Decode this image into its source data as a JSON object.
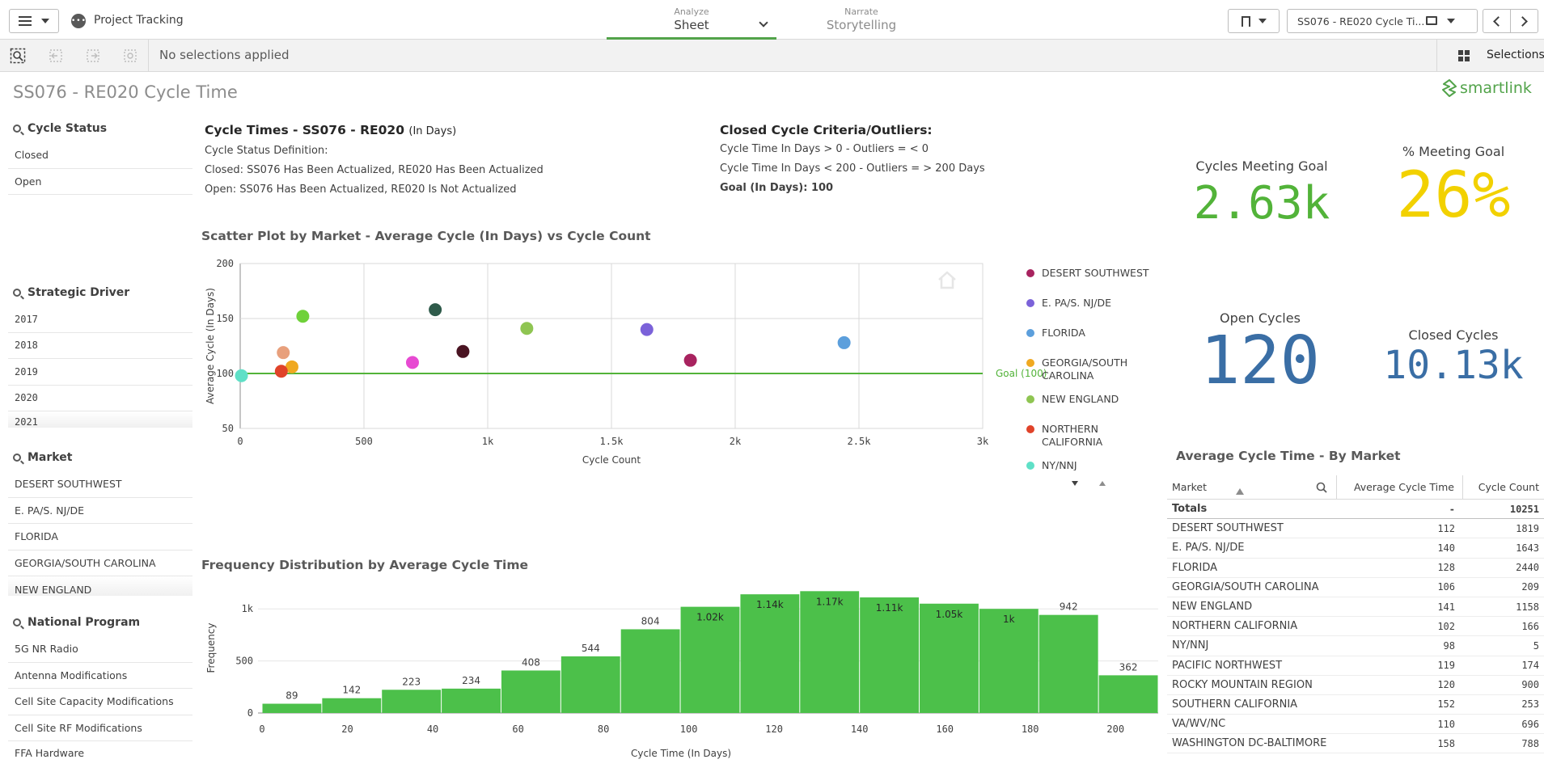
{
  "topbar": {
    "app_name": "Project Tracking",
    "tabs": [
      {
        "small": "Analyze",
        "big": "Sheet"
      },
      {
        "small": "Narrate",
        "big": "Storytelling"
      }
    ],
    "sheet_selector": "SS076 - RE020 Cycle Ti..."
  },
  "selection_bar": {
    "status": "No selections applied",
    "selections_label": "Selections"
  },
  "sheet": {
    "title": "SS076 - RE020 Cycle Time",
    "logo_text": "smartlink"
  },
  "filters": [
    {
      "title": "Cycle Status",
      "items": [
        "Closed",
        "Open"
      ]
    },
    {
      "title": "Strategic Driver",
      "items": [
        "2017",
        "2018",
        "2019",
        "2020",
        "2021"
      ]
    },
    {
      "title": "Market",
      "items": [
        "DESERT SOUTHWEST",
        "E. PA/S. NJ/DE",
        "FLORIDA",
        "GEORGIA/SOUTH CAROLINA",
        "NEW ENGLAND"
      ]
    },
    {
      "title": "National Program",
      "items": [
        "5G NR Radio",
        "Antenna Modifications",
        "Cell Site Capacity Modifications",
        "Cell Site RF Modifications",
        "FFA Hardware"
      ]
    }
  ],
  "definitions": {
    "title": "Cycle Times - SS076 - RE020",
    "title_suffix": "(In Days)",
    "line1": "Cycle Status Definition:",
    "line2": "Closed: SS076 Has Been Actualized, RE020 Has Been Actualized",
    "line3": "Open: SS076 Has Been Actualized, RE020 Is Not Actualized"
  },
  "criteria": {
    "title": "Closed Cycle Criteria/Outliers:",
    "line1": "Cycle Time In Days > 0 - Outliers = < 0",
    "line2": "Cycle Time In Days < 200 - Outliers = > 200 Days",
    "goal_label": "Goal (In Days): 100"
  },
  "kpis": {
    "meeting_goal": {
      "label": "Cycles Meeting Goal",
      "value": "2.63k",
      "color": "#52b339"
    },
    "pct_meeting": {
      "label": "% Meeting Goal",
      "value": "26%",
      "color": "#f2d100"
    },
    "open_cycles": {
      "label": "Open Cycles",
      "value": "120",
      "color": "#3a6ea5"
    },
    "closed_cycles": {
      "label": "Closed Cycles",
      "value": "10.13k",
      "color": "#3a6ea5"
    }
  },
  "scatter": {
    "title": "Scatter Plot by Market - Average Cycle (In Days) vs Cycle Count",
    "goal_label": "Goal (100)",
    "legend_visible": [
      "DESERT SOUTHWEST",
      "E. PA/S. NJ/DE",
      "FLORIDA",
      "GEORGIA/SOUTH CAROLINA",
      "NEW ENGLAND",
      "NORTHERN CALIFORNIA",
      "NY/NNJ"
    ]
  },
  "histogram": {
    "title": "Frequency Distribution by Average Cycle Time"
  },
  "table": {
    "title": "Average Cycle Time - By Market",
    "headers": [
      "Market",
      "Average Cycle Time",
      "Cycle Count"
    ],
    "totals": [
      "Totals",
      "-",
      "10251"
    ],
    "rows": [
      [
        "DESERT SOUTHWEST",
        "112",
        "1819"
      ],
      [
        "E. PA/S. NJ/DE",
        "140",
        "1643"
      ],
      [
        "FLORIDA",
        "128",
        "2440"
      ],
      [
        "GEORGIA/SOUTH CAROLINA",
        "106",
        "209"
      ],
      [
        "NEW ENGLAND",
        "141",
        "1158"
      ],
      [
        "NORTHERN CALIFORNIA",
        "102",
        "166"
      ],
      [
        "NY/NNJ",
        "98",
        "5"
      ],
      [
        "PACIFIC NORTHWEST",
        "119",
        "174"
      ],
      [
        "ROCKY MOUNTAIN REGION",
        "120",
        "900"
      ],
      [
        "SOUTHERN CALIFORNIA",
        "152",
        "253"
      ],
      [
        "VA/WV/NC",
        "110",
        "696"
      ],
      [
        "WASHINGTON DC-BALTIMORE",
        "158",
        "788"
      ]
    ]
  },
  "chart_data": [
    {
      "type": "scatter",
      "title": "Scatter Plot by Market - Average Cycle (In Days) vs Cycle Count",
      "xlabel": "Cycle Count",
      "ylabel": "Average Cycle (In Days)",
      "xlim": [
        0,
        3000
      ],
      "ylim": [
        50,
        200
      ],
      "x_ticks": [
        0,
        500,
        1000,
        1500,
        2000,
        2500,
        3000
      ],
      "x_tick_labels": [
        "0",
        "500",
        "1k",
        "1.5k",
        "2k",
        "2.5k",
        "3k"
      ],
      "y_ticks": [
        50,
        100,
        150,
        200
      ],
      "reference_line": {
        "y": 100,
        "label": "Goal (100)",
        "color": "#52b339"
      },
      "legend_position": "right",
      "points": [
        {
          "name": "DESERT SOUTHWEST",
          "x": 1819,
          "y": 112,
          "color": "#a8235f"
        },
        {
          "name": "E. PA/S. NJ/DE",
          "x": 1643,
          "y": 140,
          "color": "#7b62d9"
        },
        {
          "name": "FLORIDA",
          "x": 2440,
          "y": 128,
          "color": "#5c9fdc"
        },
        {
          "name": "GEORGIA/SOUTH CAROLINA",
          "x": 209,
          "y": 106,
          "color": "#f0a921"
        },
        {
          "name": "NEW ENGLAND",
          "x": 1158,
          "y": 141,
          "color": "#8fc552"
        },
        {
          "name": "NORTHERN CALIFORNIA",
          "x": 166,
          "y": 102,
          "color": "#e0432a"
        },
        {
          "name": "NY/NNJ",
          "x": 5,
          "y": 98,
          "color": "#5fe0c7"
        },
        {
          "name": "PACIFIC NORTHWEST",
          "x": 174,
          "y": 119,
          "color": "#e8a07c"
        },
        {
          "name": "ROCKY MOUNTAIN REGION",
          "x": 900,
          "y": 120,
          "color": "#4a1422"
        },
        {
          "name": "SOUTHERN CALIFORNIA",
          "x": 253,
          "y": 152,
          "color": "#6fd13a"
        },
        {
          "name": "VA/WV/NC",
          "x": 696,
          "y": 110,
          "color": "#e74ad2"
        },
        {
          "name": "WASHINGTON DC-BALTIMORE",
          "x": 788,
          "y": 158,
          "color": "#2e5a4a"
        }
      ]
    },
    {
      "type": "bar",
      "title": "Frequency Distribution by Average Cycle Time",
      "xlabel": "Cycle Time (In Days)",
      "ylabel": "Frequency",
      "bin_width": 14,
      "bin_starts": [
        0,
        14,
        28,
        42,
        56,
        70,
        84,
        98,
        112,
        126,
        140,
        154,
        168,
        182,
        196
      ],
      "values": [
        89,
        142,
        223,
        234,
        408,
        544,
        804,
        1020,
        1140,
        1170,
        1110,
        1050,
        1000,
        942,
        362
      ],
      "data_labels": [
        "89",
        "142",
        "223",
        "234",
        "408",
        "544",
        "804",
        "1.02k",
        "1.14k",
        "1.17k",
        "1.11k",
        "1.05k",
        "1k",
        "942",
        "362"
      ],
      "xlim": [
        0,
        210
      ],
      "ylim": [
        0,
        1250
      ],
      "x_ticks": [
        0,
        20,
        40,
        60,
        80,
        100,
        120,
        140,
        160,
        180,
        200
      ],
      "y_ticks": [
        0,
        500,
        1000
      ],
      "y_tick_labels": [
        "0",
        "500",
        "1k"
      ],
      "color": "#4cc04a"
    }
  ]
}
